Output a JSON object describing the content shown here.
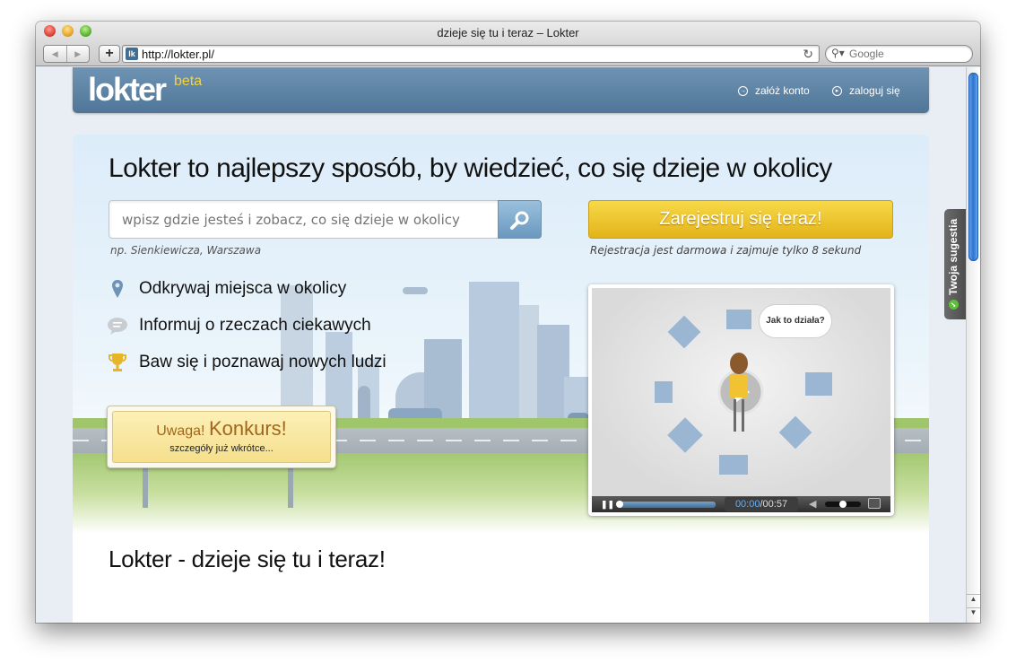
{
  "window": {
    "title": "dzieje się tu i teraz – Lokter",
    "url": "http://lokter.pl/",
    "favicon": "lk",
    "search_placeholder": "Google"
  },
  "header": {
    "logo": "lokter",
    "logo_badge": "beta",
    "links": [
      {
        "label": "załóż konto",
        "icon": "arrow-right-circle-icon"
      },
      {
        "label": "zaloguj się",
        "icon": "play-circle-icon"
      }
    ]
  },
  "hero": {
    "title": "Lokter to najlepszy sposób, by wiedzieć, co się dzieje w okolicy",
    "search_placeholder": "wpisz gdzie jesteś i zobacz, co się dzieje w okolicy",
    "search_hint": "np. Sienkiewicza, Warszawa",
    "register_label": "Zarejestruj się teraz!",
    "register_note": "Rejestracja jest darmowa i zajmuje tylko 8 sekund",
    "features": [
      {
        "label": "Odkrywaj miejsca w okolicy",
        "icon": "location-pin-icon"
      },
      {
        "label": "Informuj o rzeczach ciekawych",
        "icon": "speech-bubble-icon"
      },
      {
        "label": "Baw się i poznawaj nowych ludzi",
        "icon": "trophy-icon"
      }
    ],
    "contest": {
      "prefix": "Uwaga!",
      "headline": "Konkurs!",
      "subtext": "szczegóły już wkrótce..."
    }
  },
  "video": {
    "speech_bubble": "Jak to działa?",
    "current_time": "00:00",
    "separator": "/",
    "duration": "00:57",
    "progress": 0,
    "volume": 0.5
  },
  "tagline": "Lokter - dzieje się tu i teraz!",
  "feedback_tab": "Twoja sugestia",
  "colors": {
    "header": "#5a80a2",
    "register": "#f0c933",
    "accent_beta": "#f5d33a",
    "contest_text": "#a2661b"
  }
}
